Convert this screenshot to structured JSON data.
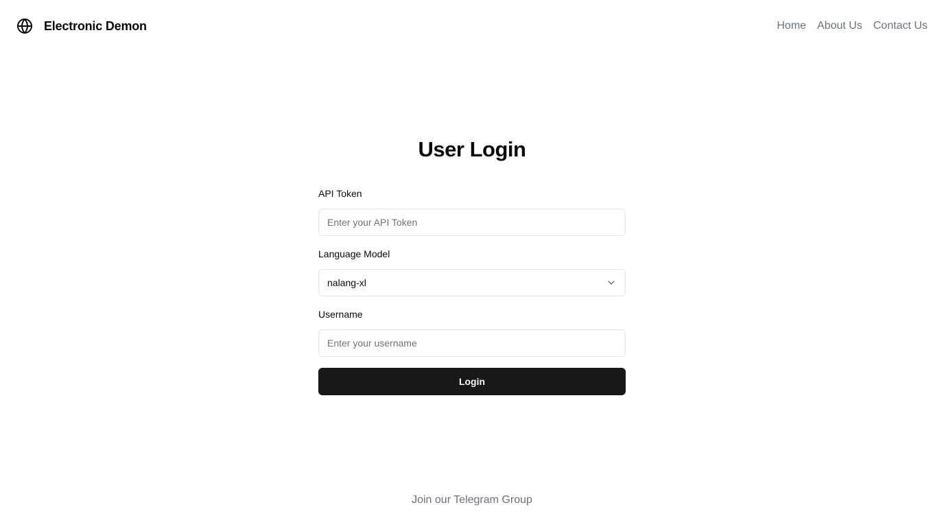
{
  "header": {
    "brand_icon": "globe-icon",
    "brand_name": "Electronic Demon",
    "nav": {
      "home": "Home",
      "about": "About Us",
      "contact": "Contact Us"
    }
  },
  "login": {
    "title": "User Login",
    "api_token": {
      "label": "API Token",
      "value": "",
      "placeholder": "Enter your API Token"
    },
    "language_model": {
      "label": "Language Model",
      "selected": "nalang-xl",
      "icon": "chevron-down-icon"
    },
    "username": {
      "label": "Username",
      "value": "",
      "placeholder": "Enter your username"
    },
    "submit_label": "Login"
  },
  "footer": {
    "telegram_link": "Join our Telegram Group"
  },
  "colors": {
    "button_bg": "#18181b",
    "button_text": "#fafafa",
    "muted_text": "#6b7280",
    "border": "#e4e4e7"
  }
}
